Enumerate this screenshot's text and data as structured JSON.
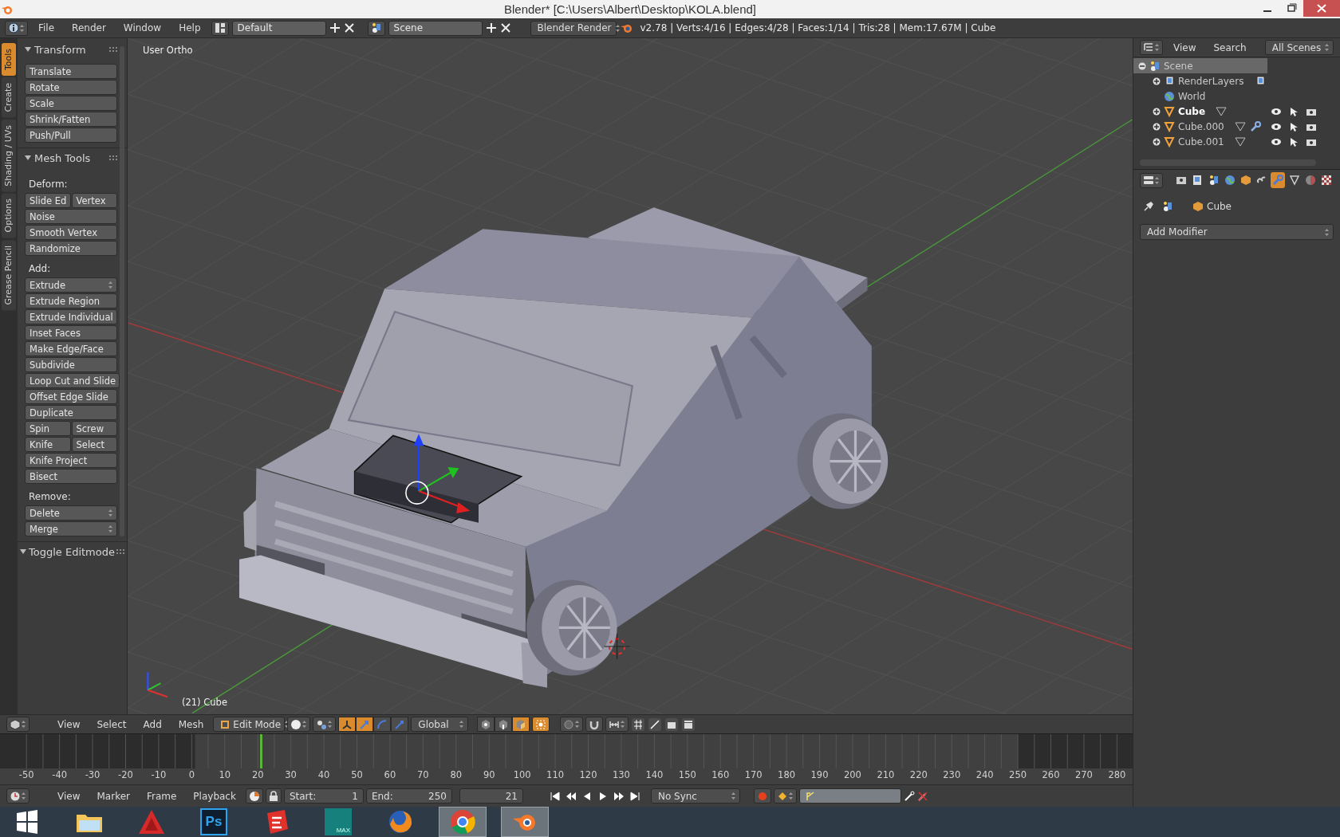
{
  "window": {
    "title": "Blender* [C:\\Users\\Albert\\Desktop\\KOLA.blend]"
  },
  "info_header": {
    "menus": [
      "File",
      "Render",
      "Window",
      "Help"
    ],
    "layout": "Default",
    "scene": "Scene",
    "engine": "Blender Render",
    "stats": "v2.78 | Verts:4/16 | Edges:4/28 | Faces:1/14 | Tris:28 | Mem:17.67M | Cube"
  },
  "tool_tabs": [
    {
      "label": "Tools",
      "selected": true
    },
    {
      "label": "Create",
      "selected": false
    },
    {
      "label": "Shading / UVs",
      "selected": false
    },
    {
      "label": "Options",
      "selected": false
    },
    {
      "label": "Grease Pencil",
      "selected": false
    }
  ],
  "tool_panel": {
    "sections": [
      {
        "title": "Transform",
        "expanded": true,
        "rows": [
          {
            "kind": "button",
            "labels": [
              "Translate"
            ]
          },
          {
            "kind": "button",
            "labels": [
              "Rotate"
            ]
          },
          {
            "kind": "button",
            "labels": [
              "Scale"
            ]
          },
          {
            "kind": "button",
            "labels": [
              "Shrink/Fatten"
            ]
          },
          {
            "kind": "button",
            "labels": [
              "Push/Pull"
            ]
          }
        ]
      },
      {
        "title": "Mesh Tools",
        "expanded": true,
        "rows": [
          {
            "kind": "label",
            "labels": [
              "Deform:"
            ]
          },
          {
            "kind": "button",
            "labels": [
              "Slide Ed",
              "Vertex"
            ]
          },
          {
            "kind": "button",
            "labels": [
              "Noise"
            ]
          },
          {
            "kind": "button",
            "labels": [
              "Smooth Vertex"
            ]
          },
          {
            "kind": "button",
            "labels": [
              "Randomize"
            ]
          },
          {
            "kind": "label",
            "labels": [
              "Add:"
            ]
          },
          {
            "kind": "dropdown",
            "labels": [
              "Extrude"
            ]
          },
          {
            "kind": "button",
            "labels": [
              "Extrude Region"
            ]
          },
          {
            "kind": "button",
            "labels": [
              "Extrude Individual"
            ]
          },
          {
            "kind": "button",
            "labels": [
              "Inset Faces"
            ]
          },
          {
            "kind": "button",
            "labels": [
              "Make Edge/Face"
            ]
          },
          {
            "kind": "button",
            "labels": [
              "Subdivide"
            ]
          },
          {
            "kind": "button",
            "labels": [
              "Loop Cut and Slide"
            ]
          },
          {
            "kind": "button",
            "labels": [
              "Offset Edge Slide"
            ]
          },
          {
            "kind": "button",
            "labels": [
              "Duplicate"
            ]
          },
          {
            "kind": "button",
            "labels": [
              "Spin",
              "Screw"
            ]
          },
          {
            "kind": "button",
            "labels": [
              "Knife",
              "Select"
            ]
          },
          {
            "kind": "button",
            "labels": [
              "Knife Project"
            ]
          },
          {
            "kind": "button",
            "labels": [
              "Bisect"
            ]
          },
          {
            "kind": "label",
            "labels": [
              "Remove:"
            ]
          },
          {
            "kind": "dropdown",
            "labels": [
              "Delete"
            ]
          },
          {
            "kind": "dropdown",
            "labels": [
              "Merge"
            ]
          }
        ]
      },
      {
        "title": "Toggle Editmode",
        "expanded": true
      }
    ]
  },
  "viewport": {
    "view_label": "User Ortho",
    "object_label": "(21) Cube"
  },
  "view3d_header": {
    "menus": [
      "View",
      "Select",
      "Add",
      "Mesh"
    ],
    "mode": "Edit Mode",
    "orientation": "Global",
    "manipulators": [
      {
        "kind": "toggle",
        "selected": true
      },
      {
        "kind": "translate",
        "selected": true
      },
      {
        "kind": "rotate",
        "selected": false
      },
      {
        "kind": "scale",
        "selected": false
      }
    ],
    "select_modes": [
      {
        "kind": "vertex",
        "selected": false
      },
      {
        "kind": "edge",
        "selected": false
      },
      {
        "kind": "face",
        "selected": true
      }
    ],
    "occlude_geometry": {
      "on": true
    }
  },
  "timeline": {
    "frame_ticks": [
      "-50",
      "-40",
      "-30",
      "-20",
      "-10",
      "0",
      "10",
      "20",
      "30",
      "40",
      "50",
      "60",
      "70",
      "80",
      "90",
      "100",
      "110",
      "120",
      "130",
      "140",
      "150",
      "160",
      "170",
      "180",
      "190",
      "200",
      "210",
      "220",
      "230",
      "240",
      "250",
      "260",
      "270",
      "280"
    ]
  },
  "timeline_header": {
    "menus": [
      "View",
      "Marker",
      "Frame",
      "Playback"
    ],
    "start_label": "Start:",
    "start": "1",
    "end_label": "End:",
    "end": "250",
    "current": "21",
    "sync": "No Sync"
  },
  "outliner": {
    "menus": [
      "View",
      "Search"
    ],
    "filter": "All Scenes",
    "tree": [
      {
        "label": "Scene",
        "kind": "scene",
        "selected": true,
        "expanded": true,
        "children": [
          {
            "label": "RenderLayers",
            "kind": "renderlayers",
            "selected": false,
            "expanded": false,
            "active": false
          },
          {
            "label": "World",
            "kind": "world",
            "selected": false,
            "active": false
          },
          {
            "label": "Cube",
            "kind": "mesh",
            "selected": false,
            "expanded": false,
            "active": true,
            "has_modifier": false
          },
          {
            "label": "Cube.000",
            "kind": "mesh",
            "selected": false,
            "expanded": false,
            "active": false,
            "has_modifier": true
          },
          {
            "label": "Cube.001",
            "kind": "mesh",
            "selected": false,
            "expanded": false,
            "active": false,
            "has_modifier": false
          }
        ]
      }
    ]
  },
  "properties": {
    "tabs": [
      {
        "kind": "render",
        "selected": false
      },
      {
        "kind": "layers",
        "selected": false
      },
      {
        "kind": "scene",
        "selected": false
      },
      {
        "kind": "world",
        "selected": false
      },
      {
        "kind": "object",
        "selected": false
      },
      {
        "kind": "constraints",
        "selected": false
      },
      {
        "kind": "modifiers",
        "selected": true
      },
      {
        "kind": "data",
        "selected": false
      },
      {
        "kind": "material",
        "selected": false
      },
      {
        "kind": "texture",
        "selected": false
      }
    ],
    "context": "Cube",
    "add_button": "Add Modifier"
  },
  "taskbar": {
    "apps": [
      {
        "kind": "start",
        "selected": false
      },
      {
        "kind": "folder",
        "selected": false
      },
      {
        "kind": "autocad",
        "selected": false
      },
      {
        "kind": "photoshop",
        "label": "Ps",
        "selected": false
      },
      {
        "kind": "sketchup",
        "selected": false
      },
      {
        "kind": "max",
        "label": "MAX",
        "selected": false
      },
      {
        "kind": "firefox",
        "selected": false
      },
      {
        "kind": "chrome",
        "selected": true
      },
      {
        "kind": "blender",
        "selected": true
      }
    ]
  }
}
